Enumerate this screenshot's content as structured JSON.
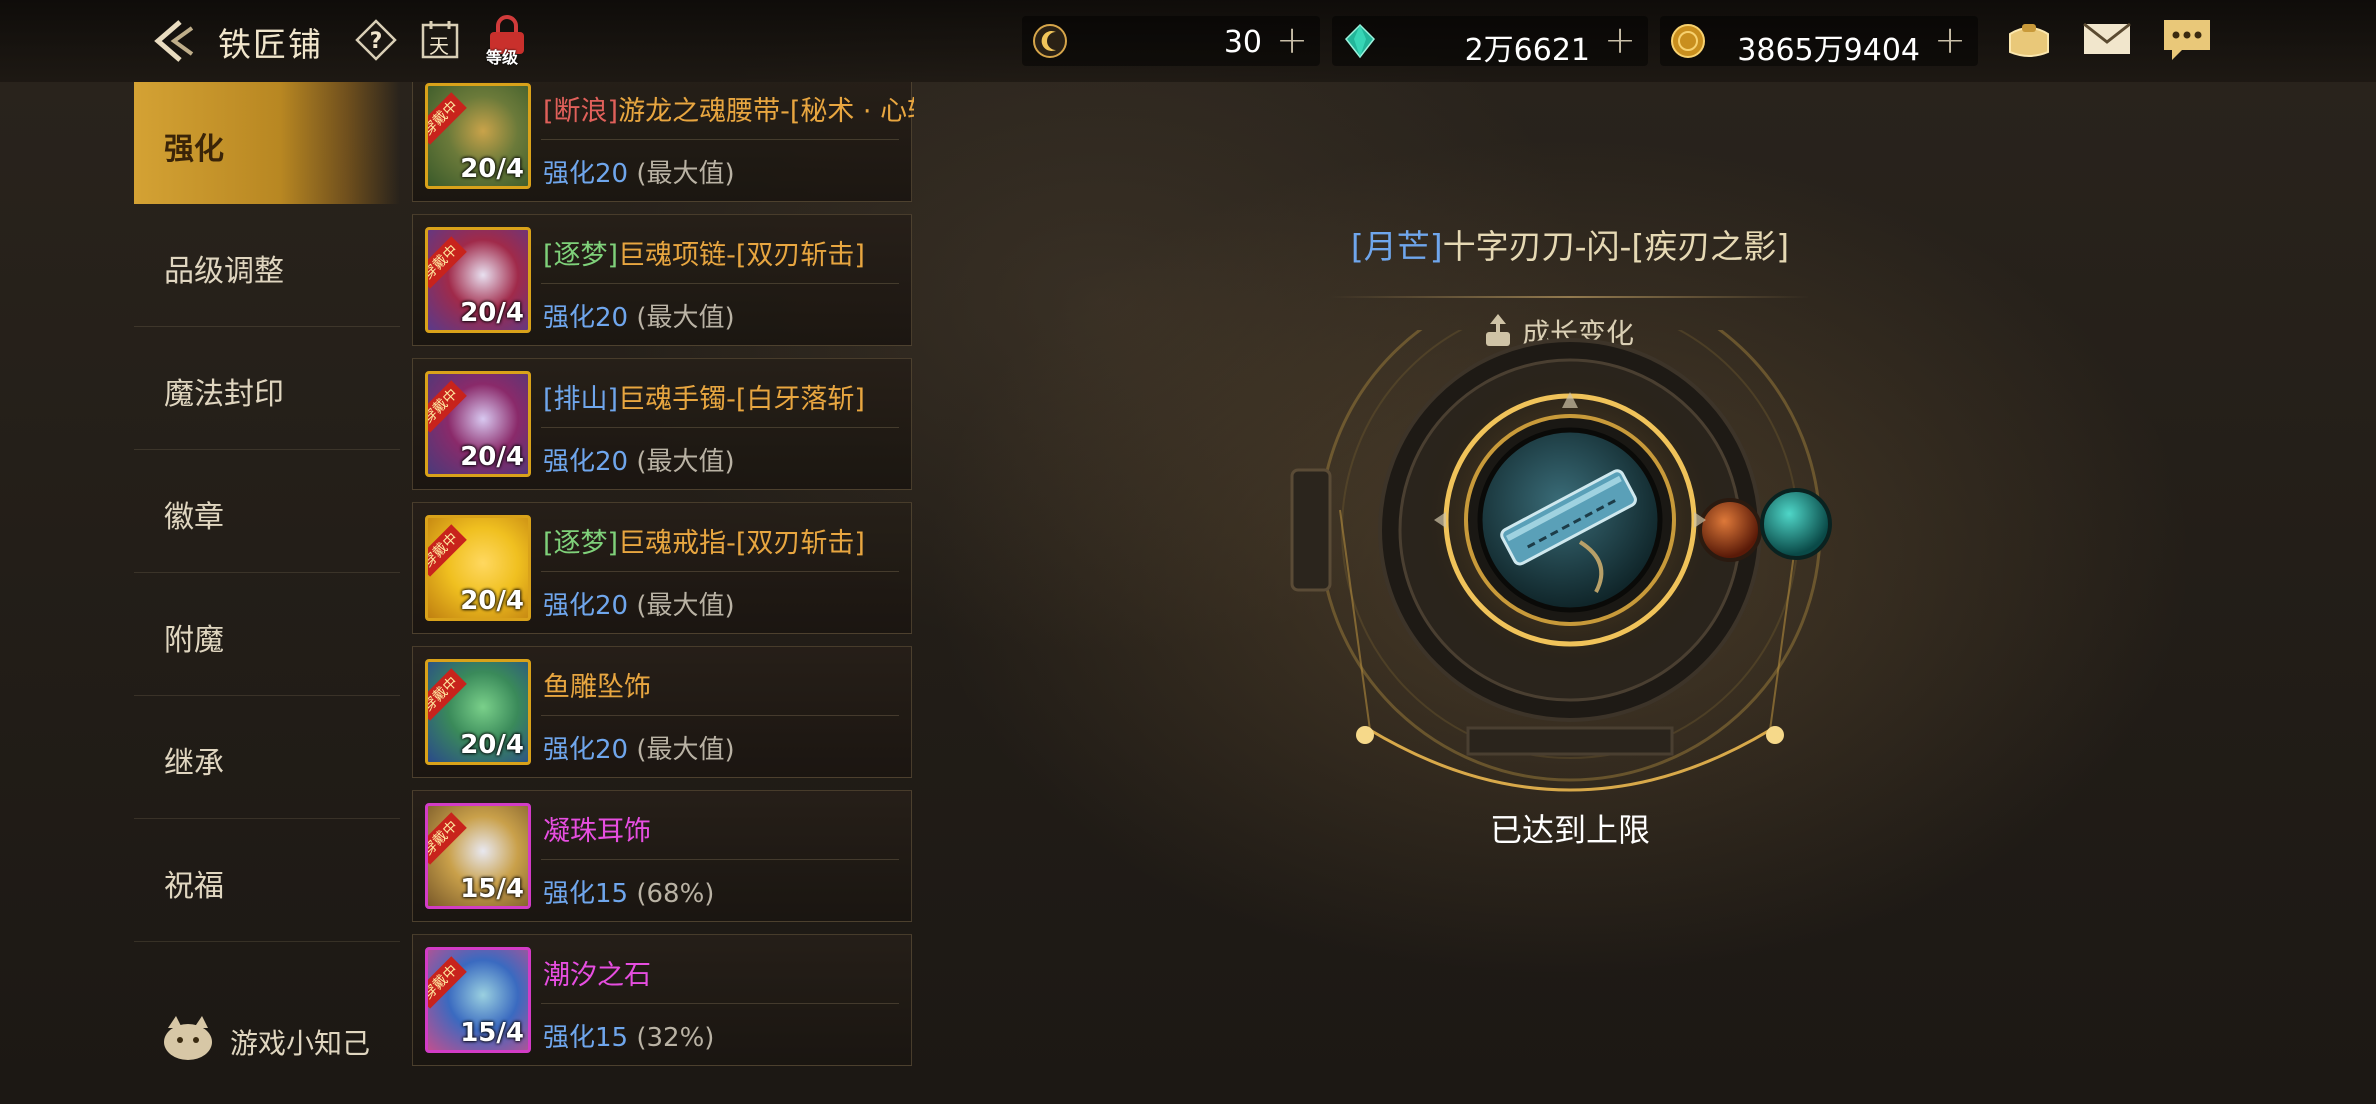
{
  "header": {
    "title": "铁匠铺",
    "icons": [
      "back-arrow-icon",
      "help-icon",
      "calendar-icon",
      "level-icon"
    ],
    "level_icon_text": "等级",
    "calendar_icon_text": "天"
  },
  "resources": [
    {
      "icon": "crescent-coin-icon",
      "value": "30"
    },
    {
      "icon": "green-gem-icon",
      "value": "2万6621"
    },
    {
      "icon": "gold-coin-icon",
      "value": "3865万9404"
    }
  ],
  "right_tools": [
    "bag-icon",
    "mail-icon",
    "chat-icon"
  ],
  "menu": {
    "items": [
      "强化",
      "品级调整",
      "魔法封印",
      "徽章",
      "附魔",
      "继承",
      "祝福"
    ],
    "active": "强化",
    "tips_label": "游戏小知己"
  },
  "equipment": [
    {
      "prefix": "[断浪]",
      "name": "游龙之魂腰带-[秘术 · 心斩]",
      "prefix_color": "#e0605a",
      "name_color": "#e8a640",
      "enhance": "强化20",
      "note": "(最大值)",
      "level": "20/4",
      "badge": "穿戴中",
      "frame": "gold"
    },
    {
      "prefix": "[逐梦]",
      "name": "巨魂项链-[双刃斩击]",
      "prefix_color": "#7fd17a",
      "name_color": "#e8a640",
      "enhance": "强化20",
      "note": "(最大值)",
      "level": "20/4",
      "badge": "穿戴中",
      "frame": "gold"
    },
    {
      "prefix": "[排山]",
      "name": "巨魂手镯-[白牙落斩]",
      "prefix_color": "#6fa6ec",
      "name_color": "#e8a640",
      "enhance": "强化20",
      "note": "(最大值)",
      "level": "20/4",
      "badge": "穿戴中",
      "frame": "gold"
    },
    {
      "prefix": "[逐梦]",
      "name": "巨魂戒指-[双刃斩击]",
      "prefix_color": "#7fd17a",
      "name_color": "#e8a640",
      "enhance": "强化20",
      "note": "(最大值)",
      "level": "20/4",
      "badge": "穿戴中",
      "frame": "gold"
    },
    {
      "prefix": "",
      "name": "鱼雕坠饰",
      "prefix_color": "#e8a640",
      "name_color": "#e8a640",
      "enhance": "强化20",
      "note": "(最大值)",
      "level": "20/4",
      "badge": "穿戴中",
      "frame": "gold"
    },
    {
      "prefix": "",
      "name": "凝珠耳饰",
      "prefix_color": "#e64ee0",
      "name_color": "#e64ee0",
      "enhance": "强化15",
      "note": "(68%)",
      "level": "15/4",
      "badge": "穿戴中",
      "frame": "pink"
    },
    {
      "prefix": "",
      "name": "潮汐之石",
      "prefix_color": "#e64ee0",
      "name_color": "#e64ee0",
      "enhance": "强化15",
      "note": "(32%)",
      "level": "15/4",
      "badge": "穿戴中",
      "frame": "pink"
    }
  ],
  "detail": {
    "prefix": "[月芒]",
    "name": "十字刃刀-闪-[疾刃之影]",
    "growth_label": "成长变化",
    "status": "已达到上限"
  }
}
